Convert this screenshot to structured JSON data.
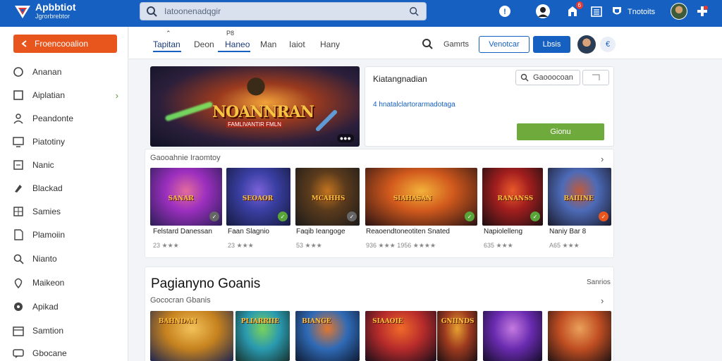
{
  "app": {
    "title": "Apbbtiot",
    "subtitle": "Jgrorbrebtor",
    "brand_color": "#1560c0",
    "accent_color": "#e8561e",
    "success_color": "#6eaa3c"
  },
  "topbar": {
    "search_placeholder": "Iatoonenadqgir",
    "notification_badge": "6",
    "user_name": "Tnotoits"
  },
  "sidebar": {
    "primary_button": "Froencooalion",
    "items": [
      {
        "label": "Ananan",
        "icon": "circle-icon"
      },
      {
        "label": "Aiplatian",
        "icon": "square-icon",
        "has_chevron": true
      },
      {
        "label": "Peandonte",
        "icon": "user-icon"
      },
      {
        "label": "Piatotiny",
        "icon": "monitor-icon"
      },
      {
        "label": "Nanic",
        "icon": "card-icon"
      },
      {
        "label": "Blackad",
        "icon": "brush-icon"
      },
      {
        "label": "Samies",
        "icon": "grid-icon"
      },
      {
        "label": "Plamoiin",
        "icon": "document-icon"
      },
      {
        "label": "Nianto",
        "icon": "search-icon"
      },
      {
        "label": "Maikeon",
        "icon": "location-icon"
      },
      {
        "label": "Apikad",
        "icon": "disc-icon"
      },
      {
        "label": "Samtion",
        "icon": "calendar-icon"
      },
      {
        "label": "Gbocane",
        "icon": "chat-icon"
      }
    ]
  },
  "tabs": {
    "items": [
      "Tapitan",
      "Deon",
      "Haneo",
      "Man",
      "Iaiot",
      "Hany"
    ],
    "active_index": 2,
    "mini_label": "P8",
    "search_label": "Gamrts",
    "outline_button": "Venotcar",
    "solid_button": "Lbsis",
    "circle_label": "€"
  },
  "hero": {
    "title": "NOANNRAN",
    "subtitle": "FAMLIVANTIR FMLN",
    "pager": "●●●"
  },
  "info_card": {
    "title": "Kiatangnadian",
    "search_button": "Gaooocoan",
    "link_text": "4 hnatalclartorarmadotaga",
    "green_button": "Gionu"
  },
  "row1": {
    "label": "Gaooahnie Iraomtoy",
    "games": [
      {
        "title": "Felstard Danessan",
        "rating": "23 ★★★",
        "art_text": "SANAR",
        "badge_color": "#666666"
      },
      {
        "title": "Faan Slagnio",
        "rating": "23 ★★★",
        "art_text": "SEOAOR",
        "badge_color": "#5aa53a"
      },
      {
        "title": "Faqib Ieangoge",
        "rating": "53 ★★★",
        "art_text": "MCAHHS",
        "badge_color": "#666666"
      },
      {
        "title": "Reaoendtoneotiten Snated",
        "rating": "936 ★★★ 1956 ★★★★",
        "art_text": "SIAHASAN",
        "badge_color": "#5aa53a"
      },
      {
        "title": "Napiolelleng",
        "rating": "635 ★★★",
        "art_text": "RANANSS",
        "badge_color": "#5aa53a"
      },
      {
        "title": "Naniy Bar 8",
        "rating": "A65 ★★★",
        "art_text": "BAIIINE",
        "badge_color": "#e8561e"
      }
    ]
  },
  "row2": {
    "section_title": "Pagianyno Goanis",
    "more_label": "Sanrios",
    "label": "Gococran Gbanis",
    "games": [
      {
        "art_text": "BAHNDAN"
      },
      {
        "art_text": "PLIARRIIE"
      },
      {
        "art_text": "BIANGE"
      },
      {
        "art_text": "SIAAOIE"
      },
      {
        "art_text": "GNIINDS"
      },
      {
        "art_text": ""
      },
      {
        "art_text": ""
      }
    ]
  }
}
